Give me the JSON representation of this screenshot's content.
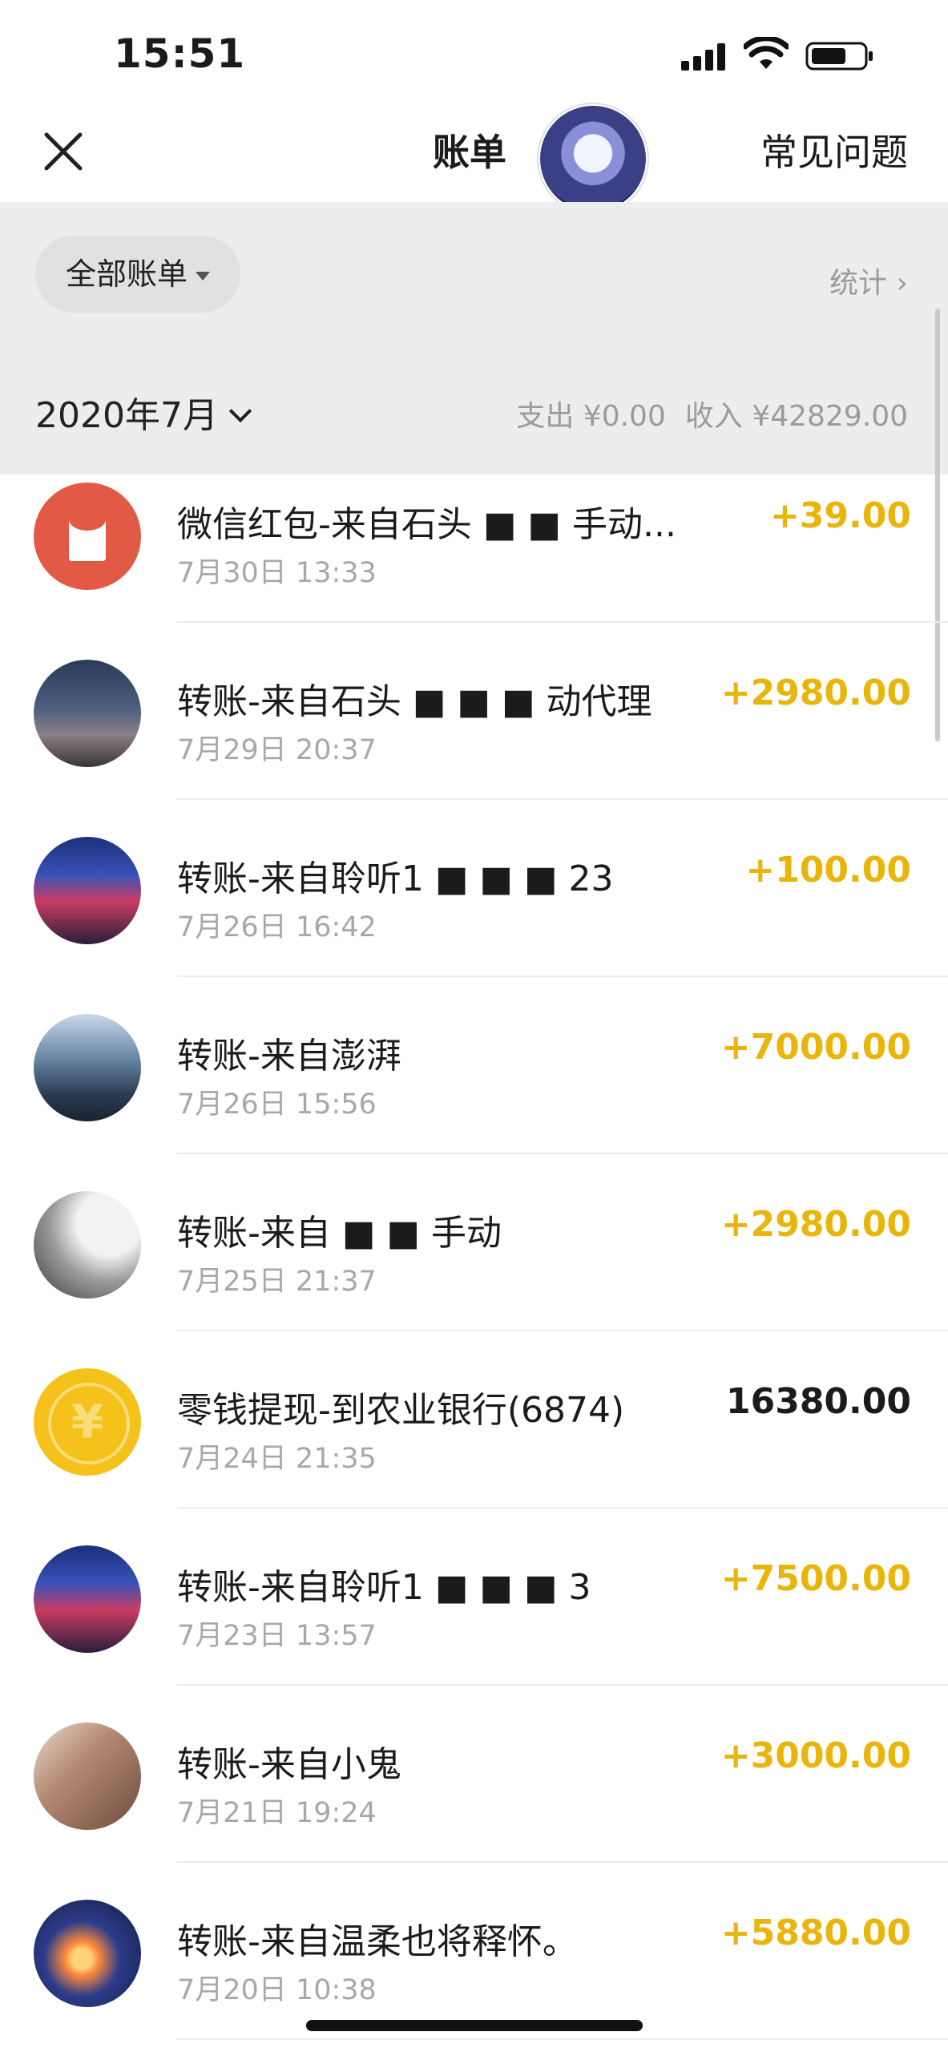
{
  "status_bar": {
    "time": "15:51"
  },
  "nav": {
    "title": "账单",
    "faq_label": "常见问题"
  },
  "filter": {
    "all_bills_label": "全部账单",
    "stats_label": "统计 ›",
    "month_label": "2020年7月",
    "expense_label": "支出 ¥0.00",
    "income_label": "收入 ¥42829.00"
  },
  "transactions": [
    {
      "title": "微信红包-来自石头 ■ ■ 手动...",
      "date": "7月30日 13:33",
      "amount": "+39.00",
      "avatar": "red-packet-icon"
    },
    {
      "title": "转账-来自石头 ■ ■ ■ 动代理",
      "date": "7月29日 20:37",
      "amount": "+2980.00",
      "avatar": "family-photo"
    },
    {
      "title": "转账-来自聆听1 ■ ■ ■ 23",
      "date": "7月26日 16:42",
      "amount": "+100.00",
      "avatar": "storefront-photo"
    },
    {
      "title": "转账-来自澎湃",
      "date": "7月26日 15:56",
      "amount": "+7000.00",
      "avatar": "sky-photo"
    },
    {
      "title": "转账-来自 ■ ■ 手动",
      "date": "7月25日 21:37",
      "amount": "+2980.00",
      "avatar": "monochrome-photo"
    },
    {
      "title": "零钱提现-到农业银行(6874)",
      "date": "7月24日 21:35",
      "amount": "16380.00",
      "avatar": "yen-coin-icon",
      "neutral": true
    },
    {
      "title": "转账-来自聆听1 ■ ■ ■ 3",
      "date": "7月23日 13:57",
      "amount": "+7500.00",
      "avatar": "storefront-photo"
    },
    {
      "title": "转账-来自小鬼",
      "date": "7月21日 19:24",
      "amount": "+3000.00",
      "avatar": "cover-face-photo"
    },
    {
      "title": "转账-来自温柔也将释怀。",
      "date": "7月20日 10:38",
      "amount": "+5880.00",
      "avatar": "glow-photo"
    }
  ],
  "colors": {
    "income_amount": "#e9b50a",
    "red_packet": "#e25a46",
    "coin": "#f4c21a",
    "filter_bg": "#ededed"
  }
}
